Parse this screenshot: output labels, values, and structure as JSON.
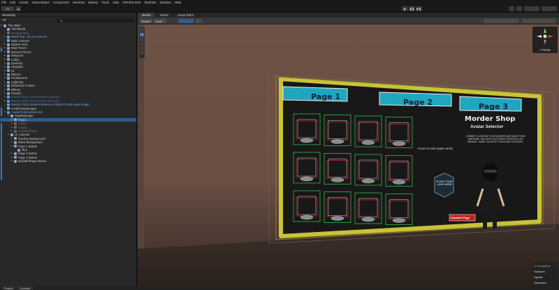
{
  "menu": [
    "File",
    "Edit",
    "Assets",
    "GameObject",
    "Component",
    "Services",
    "Bakery",
    "Tools",
    "Jobs",
    "VRChat SDK",
    "Machine",
    "Window",
    "Help"
  ],
  "toolbar": {
    "account": "CV",
    "cloud": "☁"
  },
  "hierarchy": {
    "tab": "Hierarchy",
    "search_placeholder": "All",
    "rows": [
      {
        "t": "The Strip*",
        "d": 0,
        "arr": "▾",
        "cls": ""
      },
      {
        "t": "VRCWorld",
        "d": 1,
        "arr": "",
        "cls": ""
      },
      {
        "t": "PrefabEnable",
        "d": 1,
        "arr": "",
        "cls": "dim"
      },
      {
        "t": "World Tag - Do not remove",
        "d": 1,
        "arr": "▸",
        "cls": "blue"
      },
      {
        "t": "Main Camera",
        "d": 1,
        "arr": "",
        "cls": ""
      },
      {
        "t": "Spawn Area",
        "d": 1,
        "arr": "▸",
        "cls": ""
      },
      {
        "t": "Main Room",
        "d": 1,
        "arr": "▸",
        "cls": ""
      },
      {
        "t": "Dancers Room",
        "d": 1,
        "arr": "▸",
        "cls": ""
      },
      {
        "t": "Teleports",
        "d": 1,
        "arr": "▸",
        "cls": ""
      },
      {
        "t": "Lobby",
        "d": 1,
        "arr": "▸",
        "cls": ""
      },
      {
        "t": "Systems",
        "d": 1,
        "arr": "▸",
        "cls": ""
      },
      {
        "t": "Keypads",
        "d": 1,
        "arr": "▸",
        "cls": ""
      },
      {
        "t": "UI",
        "d": 1,
        "arr": "▸",
        "cls": ""
      },
      {
        "t": "Mirrors",
        "d": 1,
        "arr": "▸",
        "cls": ""
      },
      {
        "t": "PortalsZone",
        "d": 1,
        "arr": "▸",
        "cls": ""
      },
      {
        "t": "Lightning",
        "d": 1,
        "arr": "▸",
        "cls": ""
      },
      {
        "t": "Reflection Probes",
        "d": 1,
        "arr": "▸",
        "cls": ""
      },
      {
        "t": "Effects",
        "d": 1,
        "arr": "▸",
        "cls": ""
      },
      {
        "t": "Posters",
        "d": 1,
        "arr": "▸",
        "cls": ""
      },
      {
        "t": "Murder Shop ActivationTest (Variant)",
        "d": 1,
        "arr": "▸",
        "cls": "dimblue"
      },
      {
        "t": "Murder Shop TFS Modules (Variant)",
        "d": 1,
        "arr": "▸",
        "cls": "dimblue"
      },
      {
        "t": "Murder Shop StreamCamera v.2 World Credit Asset Image",
        "d": 1,
        "arr": "",
        "cls": "blue"
      },
      {
        "t": "CreditTextManager",
        "d": 1,
        "arr": "",
        "cls": ""
      },
      {
        "t": "AvatarPedestalSelector",
        "d": 1,
        "arr": "▾",
        "cls": "blue"
      },
      {
        "t": "PageManager",
        "d": 2,
        "arr": "▾",
        "cls": ""
      },
      {
        "t": "Page1",
        "d": 3,
        "arr": "▸",
        "cls": "sel"
      },
      {
        "t": "Page2",
        "d": 3,
        "arr": "▸",
        "cls": "dim"
      },
      {
        "t": "Page3",
        "d": 3,
        "arr": "▸",
        "cls": "dim"
      },
      {
        "t": "DisabledPage",
        "d": 3,
        "arr": "▸",
        "cls": "dim"
      },
      {
        "t": "UI_Canvas",
        "d": 2,
        "arr": "▾",
        "cls": ""
      },
      {
        "t": "Overlay Background",
        "d": 3,
        "arr": "▸",
        "cls": ""
      },
      {
        "t": "Black Background",
        "d": 3,
        "arr": "▸",
        "cls": ""
      },
      {
        "t": "Page 1 Button",
        "d": 3,
        "arr": "▾",
        "cls": ""
      },
      {
        "t": "Text",
        "d": 4,
        "arr": "",
        "cls": ""
      },
      {
        "t": "Page 2 Button",
        "d": 3,
        "arr": "▸",
        "cls": ""
      },
      {
        "t": "Page 3 Button",
        "d": 3,
        "arr": "▸",
        "cls": ""
      },
      {
        "t": "DisabledPage Button",
        "d": 3,
        "arr": "▸",
        "cls": ""
      }
    ]
  },
  "scene": {
    "tabs": [
      "Scene",
      "Game",
      "Asset Store"
    ],
    "shading": "Shaded",
    "pivot": "Local",
    "persp": "< Persp",
    "nav": [
      "AI Navigation",
      "Surfaces",
      "Agents",
      "Obstacles"
    ]
  },
  "board": {
    "pages": [
      "Page 1",
      "Page 2",
      "Page 3"
    ],
    "title1": "Morder Shop",
    "title2": "Avatar Selector",
    "store_name": "YOUR STORE NAME HERE",
    "desc": "CONNECT & DISPLAY YOUR AVATARS AND MAKE THEM AWESOME. INCLUDES CUSTOMIZE PEDESTALS ON DEMAND. SOME COLOR SETTINGS AND FEATURES.",
    "place_logo": "PLACE YOUR LOGO HERE",
    "disabled": "Disabled Page",
    "colors": {
      "teal": "#1fa7bf",
      "frame": "#c9c33a",
      "green": "#39d14a",
      "red": "#e83030"
    }
  },
  "bottom": [
    "Project",
    "Console"
  ]
}
